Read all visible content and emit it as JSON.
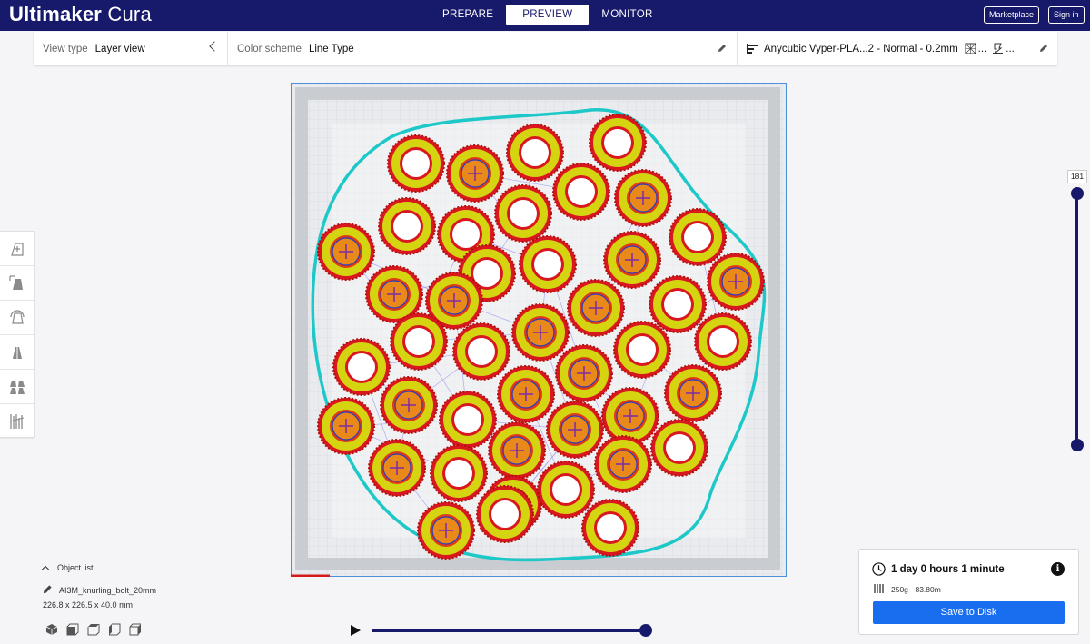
{
  "app": {
    "logo_bold": "Ultimaker",
    "logo_light": "Cura"
  },
  "stages": [
    {
      "label": "PREPARE",
      "active": false
    },
    {
      "label": "PREVIEW",
      "active": true
    },
    {
      "label": "MONITOR",
      "active": false
    }
  ],
  "header_buttons": {
    "marketplace": "Marketplace",
    "sign_in": "Sign in"
  },
  "toolbar": {
    "view_type_label": "View type",
    "view_type_value": "Layer view",
    "color_scheme_label": "Color scheme",
    "color_scheme_value": "Line Type",
    "printer_profile": "Anycubic Vyper-PLA...2 - Normal - 0.2mm",
    "support_ellipsis": "...",
    "adhesion_ellipsis": "..."
  },
  "left_tools": [
    {
      "icon": "move-icon"
    },
    {
      "icon": "scale-icon"
    },
    {
      "icon": "rotate-icon"
    },
    {
      "icon": "mirror-icon"
    },
    {
      "icon": "per-model-settings-icon"
    },
    {
      "icon": "support-blocker-icon"
    }
  ],
  "layer_slider": {
    "current_layer": "181"
  },
  "playback": {
    "progress": 1.0
  },
  "object_list": {
    "header": "Object list",
    "object_name": "AI3M_knurling_bolt_20mm",
    "dimensions": "226.8 x 226.5 x 40.0 mm",
    "view_icons": [
      "3d-view-icon",
      "front-view-icon",
      "top-view-icon",
      "left-view-icon",
      "right-view-icon"
    ]
  },
  "print_info": {
    "time": "1 day 0 hours 1 minute",
    "material": "250g · 83.80m",
    "save_label": "Save to Disk"
  },
  "colors": {
    "header": "#17196b",
    "accent_blue": "#196ef0",
    "wall_red": "#d9171e",
    "infill_yellow": "#d4d411",
    "skirt_cyan": "#1ec8c8",
    "travel_purple": "#9a8cf0"
  }
}
